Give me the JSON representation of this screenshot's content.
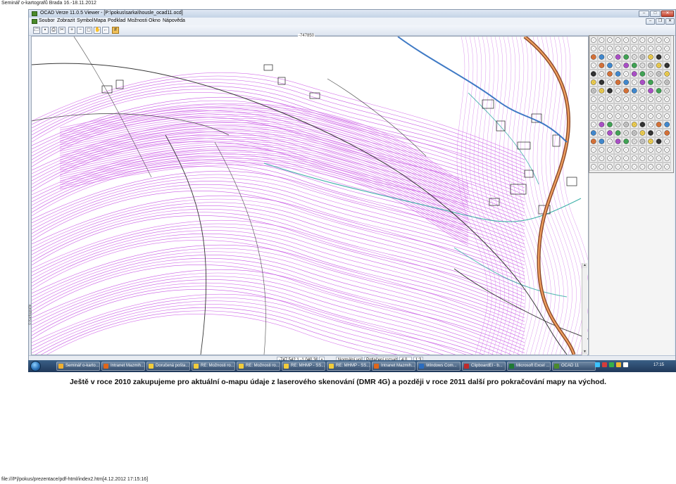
{
  "page": {
    "header": "Seminář o-kartografů Brada 16.-18.11.2012",
    "caption": "Ještě v roce 2010 zakupujeme pro aktuální o-mapu údaje z laserového skenování (DMR 4G) a později v roce 2011 další pro pokračování mapy na východ.",
    "footer": "file:///P|/pokus/prezentace/pdf-html/index2.htm[4.12.2012 17:15:16]"
  },
  "window": {
    "title": "OCAD Verze 11.0.5 Viewer - [P:\\pokus\\sarka\\housle_ocad11.ocd]",
    "buttons": {
      "minimize": "–",
      "maximize": "□",
      "close": "✕",
      "mdi_minimize": "–",
      "mdi_restore": "❐",
      "mdi_close": "✕"
    }
  },
  "menu": [
    "Soubor",
    "Zobrazit",
    "Symbol",
    "Mapa",
    "Podklad",
    "Možnosti",
    "Okno",
    "Nápověda"
  ],
  "toolbar": {
    "icons": [
      "open-icon",
      "save-icon",
      "print-icon",
      "cut-icon",
      "zoom-in-icon",
      "zoom-out-icon",
      "zoom-fit-icon",
      "hand-icon",
      "back-icon",
      "grid-icon"
    ],
    "glyphs": [
      "🗁",
      "▪",
      "⎙",
      "✂",
      "+",
      "−",
      "◻",
      "✋",
      "←",
      "#"
    ]
  },
  "map": {
    "top_coordinate": "-747850",
    "colors": {
      "contour": "#c040e0",
      "contour_dense": "#cf5ae8",
      "road": "#8b4a2a",
      "road_inner": "#f0a060",
      "water": "#2aa8a0",
      "black": "#222222",
      "blue": "#2a6cbf"
    }
  },
  "status": {
    "coords": "-747 542,1   -1 040 361,4",
    "mode": "Normální volba",
    "hint": "Potlačení rozsahu",
    "zoom": "4,0",
    "extra": "1:3"
  },
  "side_text": "© Kartografie",
  "taskbar": {
    "items": [
      {
        "label": "Seminář o-karto...",
        "color": "#f0b030"
      },
      {
        "label": "Intranet Mazmih...",
        "color": "#e0661a"
      },
      {
        "label": "Doručená pošta...",
        "color": "#f2cc3a"
      },
      {
        "label": "RE: Možnosti ro...",
        "color": "#f2cc3a"
      },
      {
        "label": "RE: Možnosti ro...",
        "color": "#f2cc3a"
      },
      {
        "label": "RE: MHMP - SS...",
        "color": "#f2cc3a"
      },
      {
        "label": "RE: MHMP - SS...",
        "color": "#f2cc3a"
      },
      {
        "label": "Intranet Mazmih...",
        "color": "#e0661a"
      },
      {
        "label": "Windows Com...",
        "color": "#2a6cbf"
      },
      {
        "label": "ClipboardEl - b...",
        "color": "#c02a2a"
      },
      {
        "label": "Microsoft Excel ...",
        "color": "#1e7a34"
      },
      {
        "label": "OCAD 11",
        "color": "#4a8a2a"
      }
    ],
    "clock": "17:15",
    "tray_colors": [
      "#3cc3ff",
      "#d43c3c",
      "#35b04a",
      "#f2b632",
      "#ffffff"
    ]
  }
}
